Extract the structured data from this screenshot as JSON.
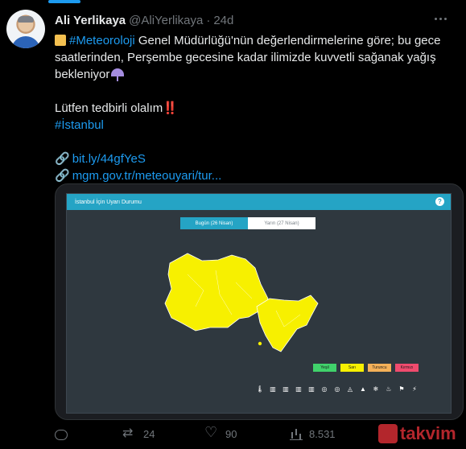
{
  "tweet": {
    "author_name": "Ali Yerlikaya",
    "handle": "@AliYerlikaya",
    "separator": "·",
    "time": "24d",
    "lines": {
      "l1_hashtag": "#Meteoroloji",
      "l1_rest": " Genel Müdürlüğü'nün değerlendirmelerine göre; bu gece",
      "l2": "saatlerinden, Perşembe gecesine kadar ilimizde kuvvetli sağanak yağış",
      "l3": "bekleniyor",
      "l4": "Lütfen tedbirli olalım",
      "l4_emoji": "‼️",
      "hashtag_istanbul": "#İstanbul",
      "link1": "bit.ly/44gfYeS",
      "link2": "mgm.gov.tr/meteouyari/tur..."
    },
    "colors": {
      "accent": "#1d9bf0",
      "background": "#000000",
      "text": "#e7e9ea",
      "muted": "#71767b"
    }
  },
  "map_card": {
    "title": "İstanbul İçin Uyarı Durumu",
    "help": "?",
    "tab_today": "Bugün (26 Nisan)",
    "tab_tomorrow": "Yarın (27 Nisan)",
    "legend": [
      "Yeşil",
      "Sarı",
      "Turuncu",
      "Kırmızı"
    ],
    "hazard_icons": [
      "🌡",
      "▥",
      "▥",
      "▥",
      "▥",
      "◎",
      "◎",
      "◬",
      "▲",
      "❄",
      "♨",
      "⚑",
      "⚡"
    ],
    "region_color": "#f7f000",
    "region_level": "yellow"
  },
  "actions": {
    "retweets": "24",
    "likes": "90",
    "views": "8.531"
  },
  "watermark": {
    "text": "takvim"
  }
}
